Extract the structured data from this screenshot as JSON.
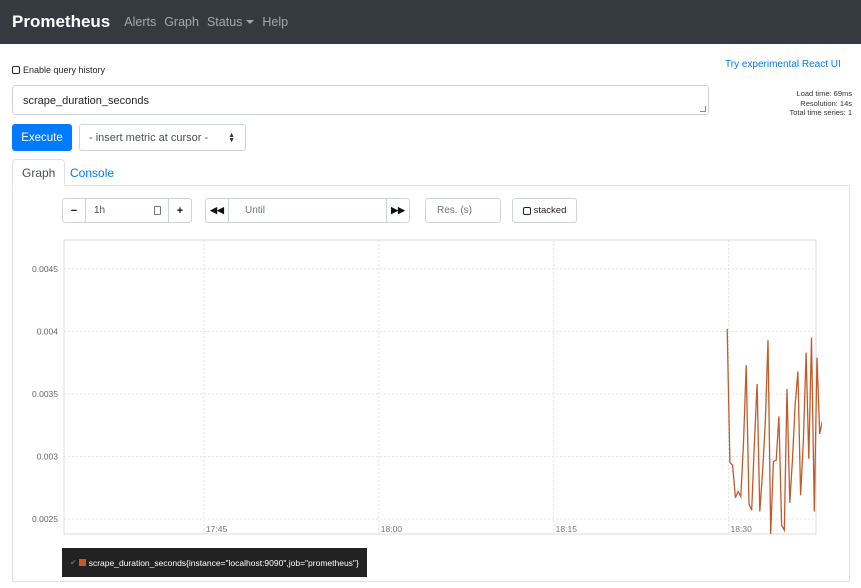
{
  "nav": {
    "brand": "Prometheus",
    "links": [
      "Alerts",
      "Graph",
      "Status",
      "Help"
    ]
  },
  "react_link": "Try experimental React UI",
  "history_label": "Enable query history",
  "expression": "scrape_duration_seconds",
  "stats": {
    "load_time": "Load time: 69ms",
    "resolution": "Resolution: 14s",
    "total_series": "Total time series: 1"
  },
  "execute_label": "Execute",
  "metric_select": "- insert metric at cursor -",
  "tabs": [
    "Graph",
    "Console"
  ],
  "controls": {
    "range": "1h",
    "until_placeholder": "Until",
    "res_placeholder": "Res. (s)",
    "stacked": "stacked"
  },
  "legend": "scrape_duration_seconds{instance=\"localhost:9090\",job=\"prometheus\"}",
  "colors": {
    "navbar": "#343a40",
    "accent": "#007bff",
    "series": "#c45a2a"
  },
  "chart_data": {
    "type": "line",
    "x_ticks": [
      "17:45",
      "18:00",
      "18:15",
      "18:30"
    ],
    "y_ticks": [
      "0.0025",
      "0.003",
      "0.0035",
      "0.004",
      "0.0045"
    ],
    "ylim": [
      0.00238,
      0.00473
    ],
    "series": [
      {
        "name": "scrape_duration_seconds{instance=\"localhost:9090\",job=\"prometheus\"}",
        "start": "18:29:53",
        "step_seconds": 14,
        "values": [
          0.00402,
          0.00295,
          0.00293,
          0.00267,
          0.00272,
          0.00268,
          0.00311,
          0.00373,
          0.00262,
          0.00257,
          0.00311,
          0.00358,
          0.00256,
          0.00288,
          0.00327,
          0.00393,
          0.00238,
          0.00296,
          0.00297,
          0.00332,
          0.00245,
          0.00241,
          0.00354,
          0.00263,
          0.00298,
          0.00342,
          0.00368,
          0.00269,
          0.00313,
          0.00383,
          0.00298,
          0.00395,
          0.00256,
          0.00379,
          0.00318,
          0.00328,
          0.0034,
          0.00325,
          0.00339,
          0.00332,
          0.00364,
          0.00344,
          0.00346,
          0.00335,
          0.00322,
          0.00335,
          0.00286,
          0.00358,
          0.00381,
          0.00304,
          0.00306,
          0.00338,
          0.00346,
          0.00322,
          0.00363,
          0.00404,
          0.0035,
          0.00379,
          0.00345,
          0.00309,
          0.00278,
          0.00387,
          0.00334,
          0.00369,
          0.00342,
          0.00284,
          0.00354,
          0.00322,
          0.00393,
          0.00353,
          0.00292,
          0.00356,
          0.00293,
          0.00346,
          0.00328,
          0.00275,
          0.00341,
          0.00388,
          0.00381,
          0.00279,
          0.00303,
          0.00343,
          0.00397,
          0.00326,
          0.00391,
          0.00304,
          0.00354,
          0.00407,
          0.00371,
          0.00451,
          0.00373,
          0.003,
          0.00392,
          0.00411,
          0.00321
        ],
        "color": "#c45a2a"
      }
    ],
    "grid": true
  }
}
